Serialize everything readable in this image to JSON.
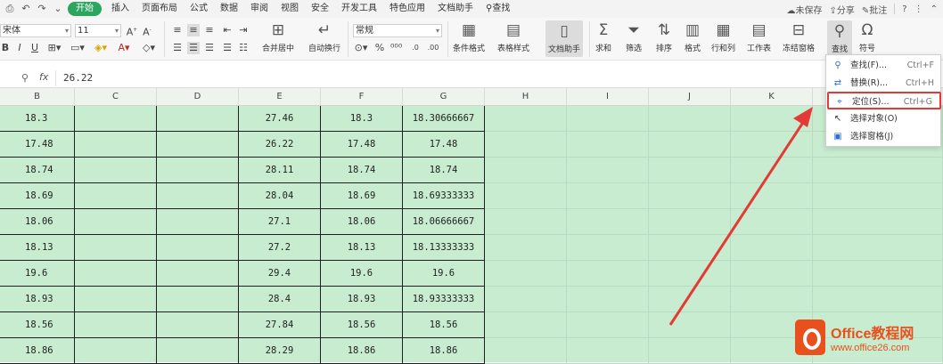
{
  "menubar": {
    "tabs": [
      "开始",
      "插入",
      "页面布局",
      "公式",
      "数据",
      "审阅",
      "视图",
      "安全",
      "开发工具",
      "特色应用",
      "文档助手",
      "查找"
    ],
    "active_tab": "开始",
    "right": {
      "unsaved": "未保存",
      "share": "分享",
      "annotate": "批注"
    }
  },
  "ribbon": {
    "font_name": "宋体",
    "font_size": "11",
    "number_format": "常规",
    "buttons": {
      "merge_center": "合并居中",
      "auto_wrap": "自动换行",
      "cond_format": "条件格式",
      "table_style": "表格样式",
      "doc_helper": "文档助手",
      "sum": "求和",
      "filter": "筛选",
      "sort": "排序",
      "format": "格式",
      "row_col": "行和列",
      "worksheet": "工作表",
      "freeze": "冻结窗格",
      "find": "查找",
      "symbol": "符号"
    }
  },
  "formula_bar": {
    "fx": "fx",
    "value": "26.22"
  },
  "columns": [
    "B",
    "C",
    "D",
    "E",
    "F",
    "G",
    "H",
    "I",
    "J",
    "K"
  ],
  "rows": [
    [
      "18.3",
      "",
      "",
      "27.46",
      "18.3",
      "18.30666667"
    ],
    [
      "17.48",
      "",
      "",
      "26.22",
      "17.48",
      "17.48"
    ],
    [
      "18.74",
      "",
      "",
      "28.11",
      "18.74",
      "18.74"
    ],
    [
      "18.69",
      "",
      "",
      "28.04",
      "18.69",
      "18.69333333"
    ],
    [
      "18.06",
      "",
      "",
      "27.1",
      "18.06",
      "18.06666667"
    ],
    [
      "18.13",
      "",
      "",
      "27.2",
      "18.13",
      "18.13333333"
    ],
    [
      "19.6",
      "",
      "",
      "29.4",
      "19.6",
      "19.6"
    ],
    [
      "18.93",
      "",
      "",
      "28.4",
      "18.93",
      "18.93333333"
    ],
    [
      "18.56",
      "",
      "",
      "27.84",
      "18.56",
      "18.56"
    ],
    [
      "18.86",
      "",
      "",
      "28.29",
      "18.86",
      "18.86"
    ]
  ],
  "dropdown": {
    "items": [
      {
        "icon": "find-icon",
        "label": "查找(F)...",
        "shortcut": "Ctrl+F"
      },
      {
        "icon": "replace-icon",
        "label": "替换(R)...",
        "shortcut": "Ctrl+H"
      },
      {
        "icon": "goto-icon",
        "label": "定位(S)...",
        "shortcut": "Ctrl+G"
      },
      {
        "icon": "select-object-icon",
        "label": "选择对象(O)",
        "shortcut": ""
      },
      {
        "icon": "select-pane-icon",
        "label": "选择窗格(J)",
        "shortcut": ""
      }
    ],
    "highlighted_index": 2
  },
  "watermark": {
    "brand": "Office教程网",
    "url": "www.office26.com"
  },
  "colors": {
    "grid_bg": "#c7eccf",
    "accent_tab": "#2ca55f",
    "highlight_box": "#e53935",
    "watermark": "#e8511d"
  }
}
